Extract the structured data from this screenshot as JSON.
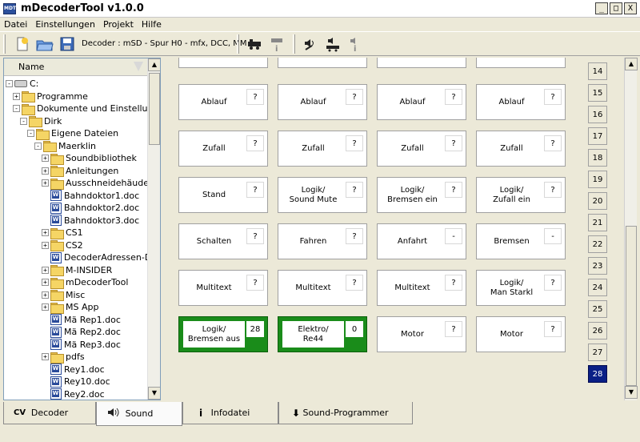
{
  "app": {
    "title": "mDecoderTool v1.0.0",
    "icon_text": "MDT",
    "window_buttons": [
      "_",
      "□",
      "X"
    ]
  },
  "menu": [
    "Datei",
    "Einstellungen",
    "Projekt",
    "Hilfe"
  ],
  "toolbar": {
    "decoder_info": "Decoder : mSD - Spur H0 - mfx, DCC, MM",
    "icons": [
      "new-file-icon",
      "open-folder-icon",
      "save-icon",
      "locomotive-icon",
      "locomotive-info-icon",
      "sound-settings-icon",
      "sound-locomotive-icon",
      "sound-info-icon"
    ]
  },
  "tree": {
    "header": "Name",
    "items": [
      {
        "label": "C:",
        "type": "drive",
        "indent": 0,
        "exp": "-"
      },
      {
        "label": "Programme",
        "type": "folder",
        "indent": 1,
        "exp": "+"
      },
      {
        "label": "Dokumente und Einstellun...",
        "type": "folder",
        "indent": 1,
        "exp": "-"
      },
      {
        "label": "Dirk",
        "type": "folder",
        "indent": 2,
        "exp": "-"
      },
      {
        "label": "Eigene Dateien",
        "type": "folder",
        "indent": 3,
        "exp": "-"
      },
      {
        "label": "Maerklin",
        "type": "folder",
        "indent": 4,
        "exp": "-"
      },
      {
        "label": "Soundbibliothek",
        "type": "folder",
        "indent": 5,
        "exp": "+"
      },
      {
        "label": "Anleitungen",
        "type": "folder",
        "indent": 5,
        "exp": "+"
      },
      {
        "label": "Ausschneidehäuder",
        "type": "folder",
        "indent": 5,
        "exp": "+"
      },
      {
        "label": "Bahndoktor1.doc",
        "type": "doc",
        "indent": 5,
        "exp": ""
      },
      {
        "label": "Bahndoktor2.doc",
        "type": "doc",
        "indent": 5,
        "exp": ""
      },
      {
        "label": "Bahndoktor3.doc",
        "type": "doc",
        "indent": 5,
        "exp": ""
      },
      {
        "label": "CS1",
        "type": "folder",
        "indent": 5,
        "exp": "+"
      },
      {
        "label": "CS2",
        "type": "folder",
        "indent": 5,
        "exp": "+"
      },
      {
        "label": "DecoderAdressen-DI...",
        "type": "doc",
        "indent": 5,
        "exp": ""
      },
      {
        "label": "M-INSIDER",
        "type": "folder",
        "indent": 5,
        "exp": "+"
      },
      {
        "label": "mDecoderTool",
        "type": "folder",
        "indent": 5,
        "exp": "+"
      },
      {
        "label": "Misc",
        "type": "folder",
        "indent": 5,
        "exp": "+"
      },
      {
        "label": "MS App",
        "type": "folder",
        "indent": 5,
        "exp": "+"
      },
      {
        "label": "Mä Rep1.doc",
        "type": "doc",
        "indent": 5,
        "exp": ""
      },
      {
        "label": "Mä Rep2.doc",
        "type": "doc",
        "indent": 5,
        "exp": ""
      },
      {
        "label": "Mä Rep3.doc",
        "type": "doc",
        "indent": 5,
        "exp": ""
      },
      {
        "label": "pdfs",
        "type": "folder",
        "indent": 5,
        "exp": "+"
      },
      {
        "label": "Rey1.doc",
        "type": "doc",
        "indent": 5,
        "exp": ""
      },
      {
        "label": "Rey10.doc",
        "type": "doc",
        "indent": 5,
        "exp": ""
      },
      {
        "label": "Rey2.doc",
        "type": "doc",
        "indent": 5,
        "exp": ""
      }
    ]
  },
  "grid": {
    "rows": [
      [
        {
          "label": "Ablauf",
          "badge": "?"
        },
        {
          "label": "Ablauf",
          "badge": "?"
        },
        {
          "label": "Ablauf",
          "badge": "?"
        },
        {
          "label": "Ablauf",
          "badge": "?"
        }
      ],
      [
        {
          "label": "Zufall",
          "badge": "?"
        },
        {
          "label": "Zufall",
          "badge": "?"
        },
        {
          "label": "Zufall",
          "badge": "?"
        },
        {
          "label": "Zufall",
          "badge": "?"
        }
      ],
      [
        {
          "label": "Stand",
          "badge": "?"
        },
        {
          "label": "Logik/\nSound Mute",
          "badge": "?"
        },
        {
          "label": "Logik/\nBremsen ein",
          "badge": "?"
        },
        {
          "label": "Logik/\nZufall ein",
          "badge": "?"
        }
      ],
      [
        {
          "label": "Schalten",
          "badge": "?"
        },
        {
          "label": "Fahren",
          "badge": "?"
        },
        {
          "label": "Anfahrt",
          "badge": "-"
        },
        {
          "label": "Bremsen",
          "badge": "-"
        }
      ],
      [
        {
          "label": "Multitext",
          "badge": "?"
        },
        {
          "label": "Multitext",
          "badge": "?"
        },
        {
          "label": "Multitext",
          "badge": "?"
        },
        {
          "label": "Logik/\nMan Starkl",
          "badge": "?"
        }
      ],
      [
        {
          "label": "Logik/\nBremsen aus",
          "badge": "28",
          "active": true
        },
        {
          "label": "Elektro/\nRe44",
          "badge": "0",
          "active": true
        },
        {
          "label": "Motor",
          "badge": "?"
        },
        {
          "label": "Motor",
          "badge": "?"
        }
      ]
    ]
  },
  "numbers": [
    "14",
    "15",
    "16",
    "17",
    "18",
    "19",
    "20",
    "21",
    "22",
    "23",
    "24",
    "25",
    "26",
    "27",
    "28"
  ],
  "selected_number": "28",
  "tabs": [
    {
      "label": "Decoder",
      "icon": "CV"
    },
    {
      "label": "Sound",
      "icon": "🔊",
      "active": true
    },
    {
      "label": "Infodatei",
      "icon": "i"
    },
    {
      "label": "Sound-Programmer",
      "icon": "⬇"
    }
  ],
  "colors": {
    "active_slot": "#1a8c1a",
    "selected_number": "#0a1f86"
  }
}
